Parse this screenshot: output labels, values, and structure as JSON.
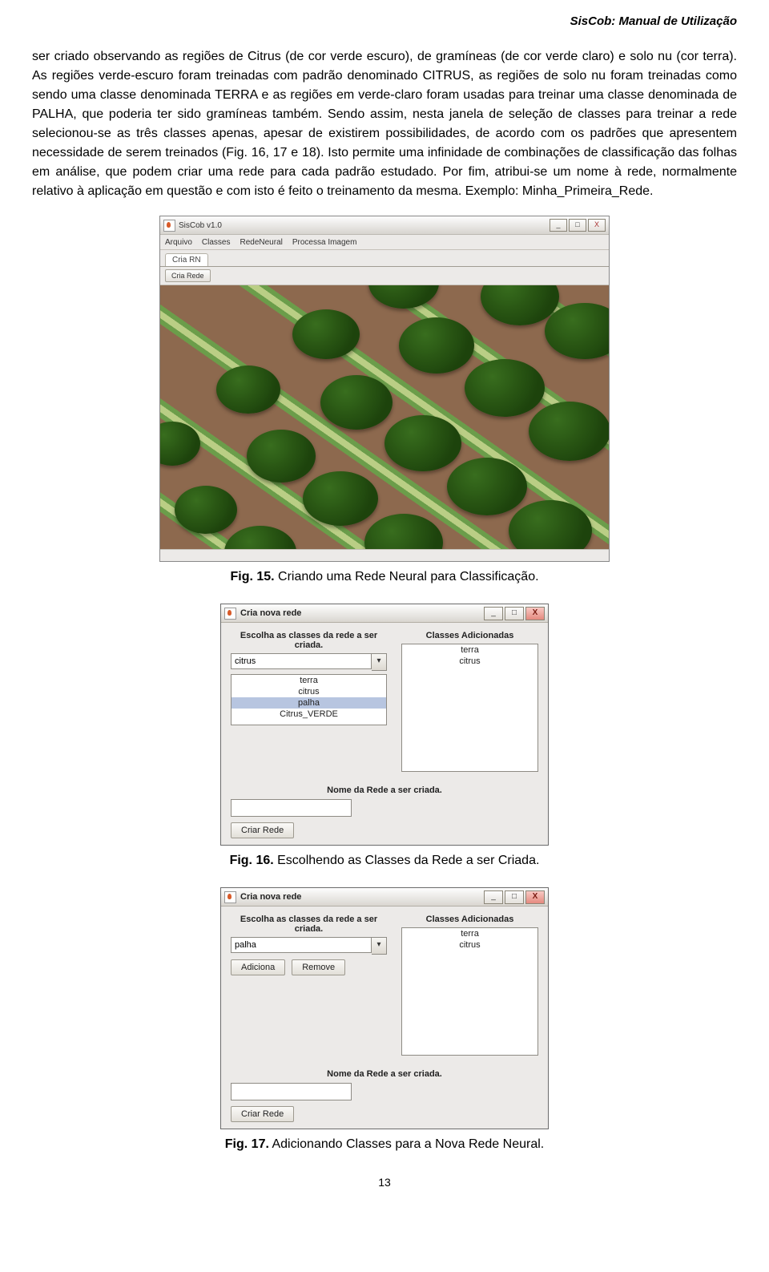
{
  "header": {
    "title": "SisCob: Manual de Utilização"
  },
  "body": {
    "p1": "ser criado observando as regiões de Citrus (de cor verde escuro), de gramíneas (de cor verde claro) e solo nu (cor terra). As regiões verde-escuro foram treinadas com padrão denominado CITRUS, as regiões de solo nu foram treinadas como sendo uma classe denominada TERRA e as regiões em verde-claro foram usadas para treinar uma classe denominada de PALHA, que poderia ter sido gramíneas também. Sendo assim, nesta janela de seleção de classes para treinar a rede selecionou-se as três classes apenas, apesar de existirem possibilidades, de acordo com os padrões que apresentem necessidade de serem treinados  (Fig. 16, 17 e 18). Isto permite uma infinidade de combinações de classificação das folhas em análise, que podem criar uma rede para cada padrão estudado. Por fim, atribui-se um nome à rede, normalmente relativo à aplicação em questão e com isto é feito o treinamento da mesma. Exemplo: Minha_Primeira_Rede."
  },
  "fig15": {
    "app_title": "SisCob v1.0",
    "menu": [
      "Arquivo",
      "Classes",
      "RedeNeural",
      "Processa Imagem"
    ],
    "tabs": [
      "Cria RN"
    ],
    "tool_button": "Cria Rede",
    "caption_label": "Fig. 15.",
    "caption_text": "  Criando uma Rede Neural para Classificação."
  },
  "fig16": {
    "dlg_title": "Cria nova rede",
    "left_label": "Escolha as classes da rede a ser criada.",
    "right_label": "Classes Adicionadas",
    "combo_value": "citrus",
    "left_list": [
      "terra",
      "citrus",
      "palha",
      "Citrus_VERDE"
    ],
    "left_selected_index": 2,
    "right_list": [
      "terra",
      "citrus"
    ],
    "name_label": "Nome da Rede a ser criada.",
    "create_btn": "Criar Rede",
    "caption_label": "Fig. 16.",
    "caption_text": "  Escolhendo as Classes da Rede a ser Criada."
  },
  "fig17": {
    "dlg_title": "Cria nova rede",
    "left_label": "Escolha as classes da rede a ser criada.",
    "right_label": "Classes Adicionadas",
    "combo_value": "palha",
    "right_list": [
      "terra",
      "citrus"
    ],
    "add_btn": "Adiciona",
    "remove_btn": "Remove",
    "name_label": "Nome da Rede a ser criada.",
    "create_btn": "Criar Rede",
    "caption_label": "Fig. 17.",
    "caption_text": "  Adicionando Classes para a Nova Rede Neural."
  },
  "page_number": "13",
  "win": {
    "min": "_",
    "max": "□",
    "close": "X",
    "dropdown": "▾"
  }
}
